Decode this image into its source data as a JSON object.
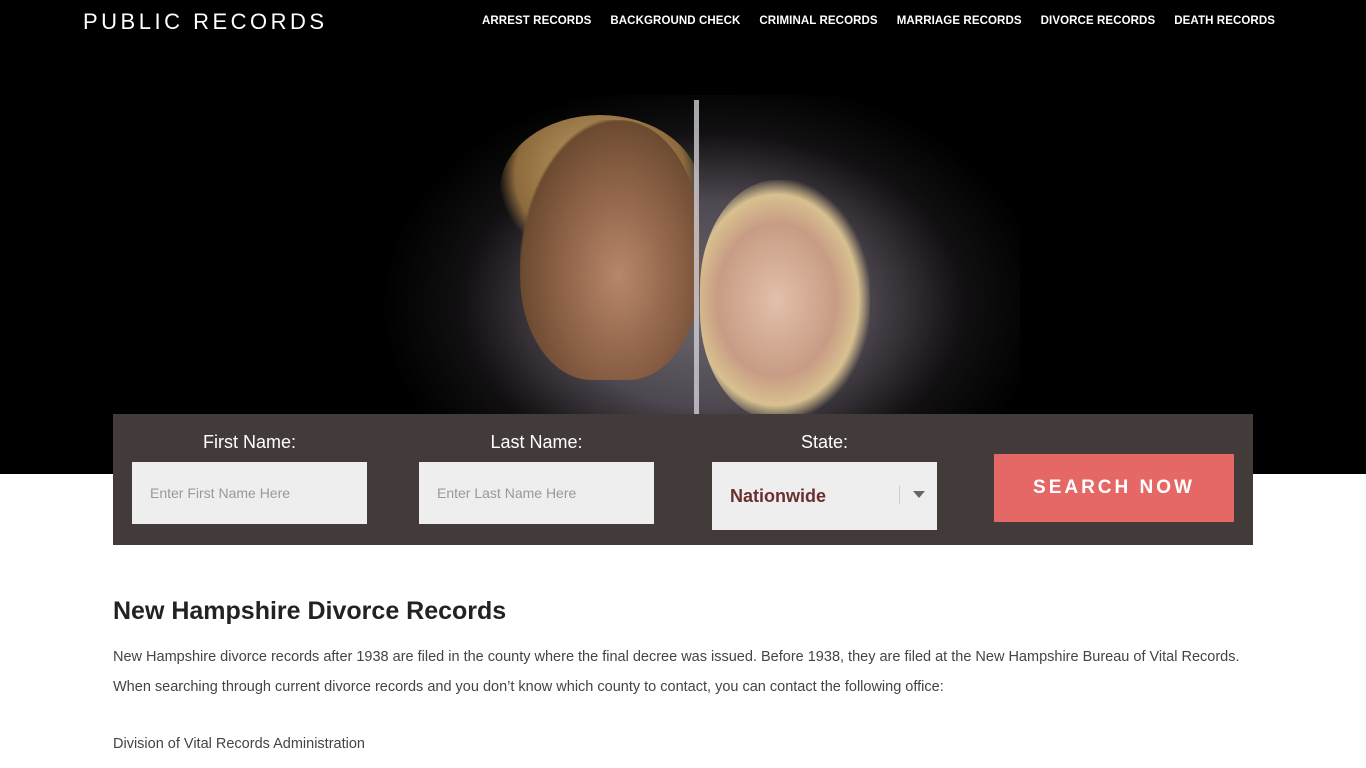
{
  "header": {
    "logo": "PUBLIC RECORDS",
    "nav": [
      "ARREST RECORDS",
      "BACKGROUND CHECK",
      "CRIMINAL RECORDS",
      "MARRIAGE RECORDS",
      "DIVORCE RECORDS",
      "DEATH RECORDS"
    ]
  },
  "search": {
    "first_label": "First Name:",
    "first_placeholder": "Enter First Name Here",
    "last_label": "Last Name:",
    "last_placeholder": "Enter Last Name Here",
    "state_label": "State:",
    "state_value": "Nationwide",
    "button": "SEARCH NOW"
  },
  "content": {
    "title": "New Hampshire Divorce Records",
    "paragraph": "New Hampshire divorce records after 1938 are filed in the county where the final decree was issued. Before 1938, they are filed at the New Hampshire Bureau of Vital Records. When searching through current divorce records and you don’t know which county to contact, you can contact the following office:",
    "office": "Division of Vital Records Administration"
  },
  "colors": {
    "form_bg": "#433b39",
    "button": "#e66866",
    "state_text": "#6b2f2f"
  }
}
